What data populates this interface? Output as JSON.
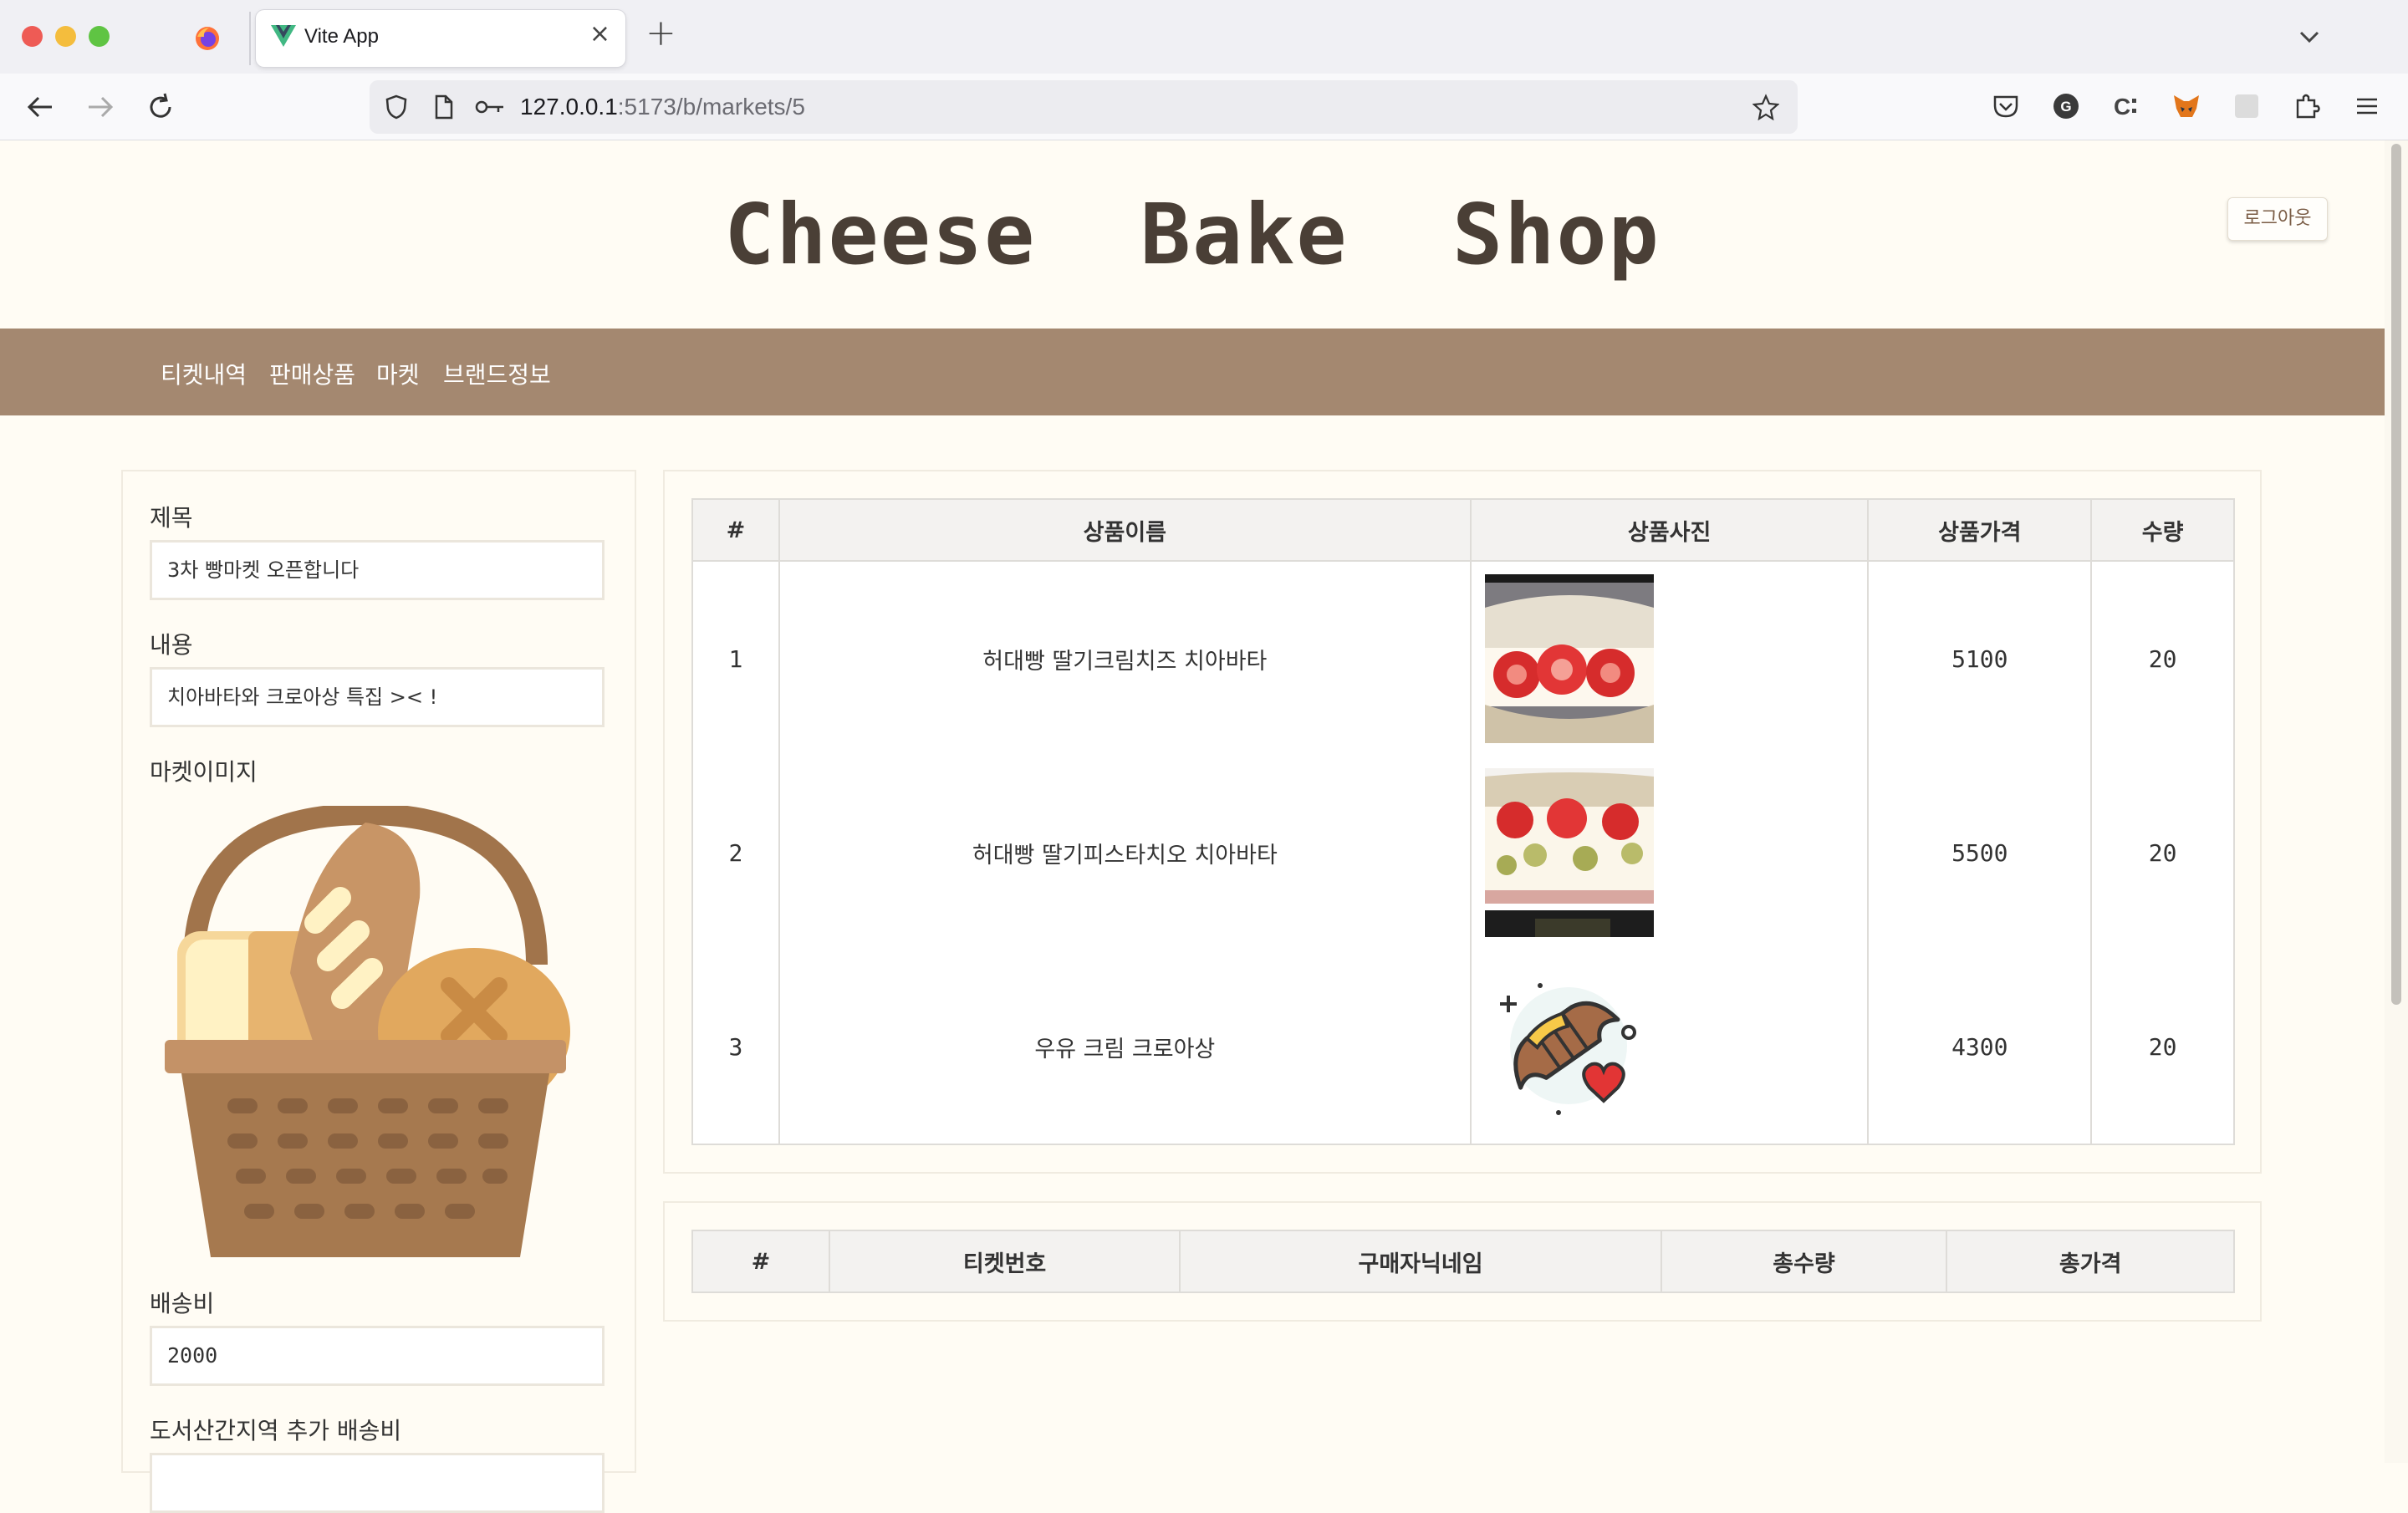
{
  "browser": {
    "tab_title": "Vite App",
    "tab_close": "×",
    "new_tab": "+",
    "url_host": "127.0.0.1",
    "url_path": ":5173/b/markets/5"
  },
  "header": {
    "site_title": "Cheese  Bake  Shop",
    "logout_label": "로그아웃"
  },
  "menu": {
    "items": [
      "티켓내역",
      "판매상품",
      "마켓",
      "브랜드정보"
    ]
  },
  "form": {
    "title_label": "제목",
    "title_value": "3차  빵마켓  오픈합니다",
    "content_label": "내용",
    "content_value": "치아바타와  크로아상  특집  ><  !",
    "image_label": "마켓이미지",
    "shipping_label": "배송비",
    "shipping_value": "2000",
    "island_label": "도서산간지역  추가  배송비"
  },
  "products": {
    "headers": [
      "#",
      "상품이름",
      "상품사진",
      "상품가격",
      "수량"
    ],
    "rows": [
      {
        "no": "1",
        "name": "허대빵  딸기크림치즈  치아바타",
        "price": "5100",
        "qty": "20",
        "image": "strawberry-cream-cheese-ciabatta"
      },
      {
        "no": "2",
        "name": "허대빵  딸기피스타치오  치아바타",
        "price": "5500",
        "qty": "20",
        "image": "strawberry-pistachio-ciabatta"
      },
      {
        "no": "3",
        "name": "우유  크림  크로아상",
        "price": "4300",
        "qty": "20",
        "image": "croissant-heart-icon"
      }
    ]
  },
  "tickets": {
    "headers": [
      "#",
      "티켓번호",
      "구매자닉네임",
      "총수량",
      "총가격"
    ]
  },
  "colors": {
    "menu_bar": "#a48870",
    "title_text": "#4a3f36",
    "page_bg": "#fffcf4"
  }
}
